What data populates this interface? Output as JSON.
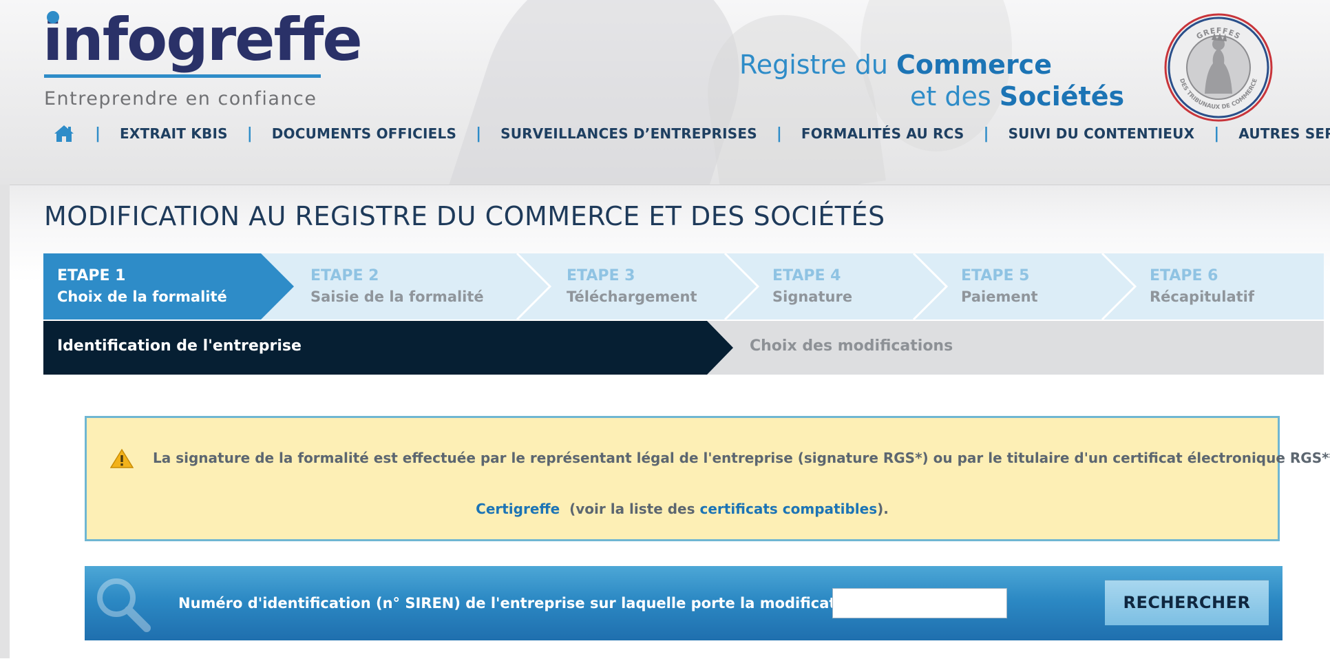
{
  "header": {
    "logo_text": "infogreffe",
    "logo_tagline": "Entreprendre en confiance",
    "rcs_line1_thin": "Registre du ",
    "rcs_line1_bold": "Commerce",
    "rcs_line2_thin": "et des ",
    "rcs_line2_bold": "Sociétés",
    "seal_text_top": "GREFFES",
    "seal_text_bottom": "DES TRIBUNAUX DE COMMERCE"
  },
  "nav": {
    "home_icon": "home-icon",
    "items": [
      {
        "label": "EXTRAIT KBIS"
      },
      {
        "label": "DOCUMENTS OFFICIELS"
      },
      {
        "label": "SURVEILLANCES D’ENTREPRISES"
      },
      {
        "label": "FORMALITÉS AU RCS"
      },
      {
        "label": "SUIVI DU CONTENTIEUX"
      },
      {
        "label": "AUTRES SERVICES"
      }
    ]
  },
  "page": {
    "title": "MODIFICATION AU REGISTRE DU COMMERCE ET DES SOCIÉTÉS"
  },
  "steps": [
    {
      "num": "ETAPE 1",
      "label": "Choix de la formalité",
      "active": true
    },
    {
      "num": "ETAPE 2",
      "label": "Saisie de la formalité",
      "active": false
    },
    {
      "num": "ETAPE 3",
      "label": "Téléchargement",
      "active": false
    },
    {
      "num": "ETAPE 4",
      "label": "Signature",
      "active": false
    },
    {
      "num": "ETAPE 5",
      "label": "Paiement",
      "active": false
    },
    {
      "num": "ETAPE 6",
      "label": "Récapitulatif",
      "active": false
    }
  ],
  "substeps": {
    "active": "Identification de l'entreprise",
    "inactive": "Choix des modifications"
  },
  "warning": {
    "icon": "warning-icon",
    "line1": "La signature de la formalité est effectuée par le représentant légal de l'entreprise (signature RGS*) ou par le titulaire d'un certificat électronique RGS** tel que",
    "link1": "Certigreffe",
    "middle": "(voir la liste des",
    "link2": "certificats compatibles",
    "end": ")."
  },
  "search": {
    "icon": "magnifier-icon",
    "label": "Numéro d'identification (n° SIREN) de l'entreprise sur laquelle porte la modification",
    "value": "",
    "button_label": "RECHERCHER"
  },
  "colors": {
    "brand_navy": "#2a3168",
    "brand_blue": "#2e8cc8",
    "step_active": "#2e8cc8",
    "step_inactive": "#dcedf7",
    "substep_active": "#061f33",
    "substep_inactive": "#dddee0",
    "warning_bg": "#fdefb5",
    "search_bg": "#2c89c4"
  }
}
